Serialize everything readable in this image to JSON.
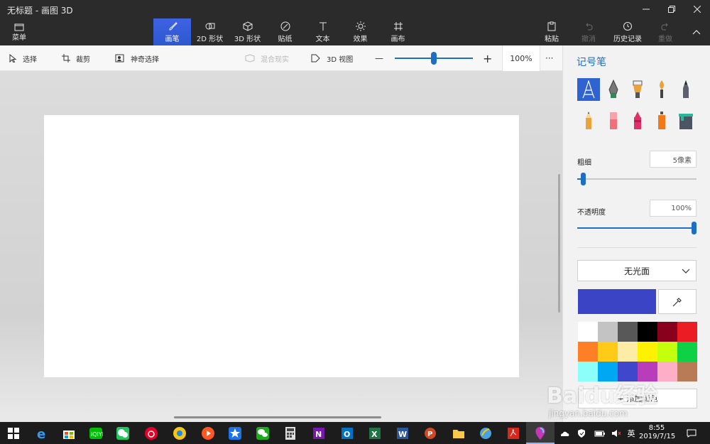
{
  "window": {
    "title": "无标题 - 画图 3D",
    "controls": [
      "minimize",
      "maximize",
      "close"
    ]
  },
  "ribbon": {
    "menu_label": "菜单",
    "tabs": [
      {
        "label": "画笔",
        "icon": "brush-icon",
        "active": true
      },
      {
        "label": "2D 形状",
        "icon": "shapes-2d-icon",
        "active": false
      },
      {
        "label": "3D 形状",
        "icon": "cube-icon",
        "active": false
      },
      {
        "label": "贴纸",
        "icon": "sticker-icon",
        "active": false
      },
      {
        "label": "文本",
        "icon": "text-icon",
        "active": false
      },
      {
        "label": "效果",
        "icon": "sun-icon",
        "active": false
      },
      {
        "label": "画布",
        "icon": "canvas-crop-icon",
        "active": false
      }
    ],
    "paste_label": "粘贴",
    "undo_label": "撤消",
    "history_label": "历史记录",
    "redo_label": "重做"
  },
  "toolbar": {
    "select_label": "选择",
    "crop_label": "裁剪",
    "magic_select_label": "神奇选择",
    "mixed_reality_label": "混合现实",
    "view3d_label": "3D 视图",
    "zoom_minus": "—",
    "zoom_plus": "+",
    "zoom_value": "100%",
    "zoom_level": 0.5,
    "more": "···"
  },
  "panel": {
    "title": "记号笔",
    "brushes": [
      {
        "name": "marker",
        "color": "#ffffff",
        "selected": true
      },
      {
        "name": "calligraphy-pen",
        "color": "#555555",
        "selected": false
      },
      {
        "name": "oil-brush",
        "color": "#e8a33a",
        "selected": false
      },
      {
        "name": "watercolor",
        "color": "#e8a33a",
        "selected": false
      },
      {
        "name": "pixel-pen",
        "color": "#555a66",
        "selected": false
      },
      {
        "name": "pencil",
        "color": "#e8a33a",
        "selected": false
      },
      {
        "name": "eraser",
        "color": "#f06f7a",
        "selected": false
      },
      {
        "name": "crayon",
        "color": "#e0306a",
        "selected": false
      },
      {
        "name": "spray-can",
        "color": "#f07a1a",
        "selected": false
      },
      {
        "name": "fill",
        "color": "#2ab79a",
        "selected": false
      }
    ],
    "thickness_label": "粗细",
    "thickness_value": "5像素",
    "thickness_level": 0.05,
    "opacity_label": "不透明度",
    "opacity_value": "100%",
    "opacity_level": 1.0,
    "finish_value": "无光面",
    "current_color": "#3a44c4",
    "swatches": [
      "#ffffff",
      "#c3c3c3",
      "#585858",
      "#000000",
      "#88001b",
      "#ec1c24",
      "#ff7f27",
      "#ffca18",
      "#fdeca6",
      "#fff200",
      "#c4ff0e",
      "#0ed145",
      "#8cfffb",
      "#00a8f3",
      "#3f48cc",
      "#b83dba",
      "#ffaec8",
      "#b97a56"
    ],
    "custom_color_label": "+ 添加颜色"
  },
  "watermark": {
    "logo": "Baidu经验",
    "url": "jingyan.baidu.com"
  },
  "taskbar": {
    "apps": [
      "windows-start",
      "edge",
      "store",
      "iqiyi",
      "wechat-green",
      "netease-music",
      "chrome-like",
      "music-app",
      "star-app",
      "wechat",
      "calculator",
      "onenote",
      "outlook",
      "excel",
      "word",
      "powerpoint",
      "file-explorer",
      "browser-globe",
      "acrobat",
      "paint3d"
    ],
    "ime": "英",
    "time": "8:55",
    "date": "2019/7/15"
  }
}
